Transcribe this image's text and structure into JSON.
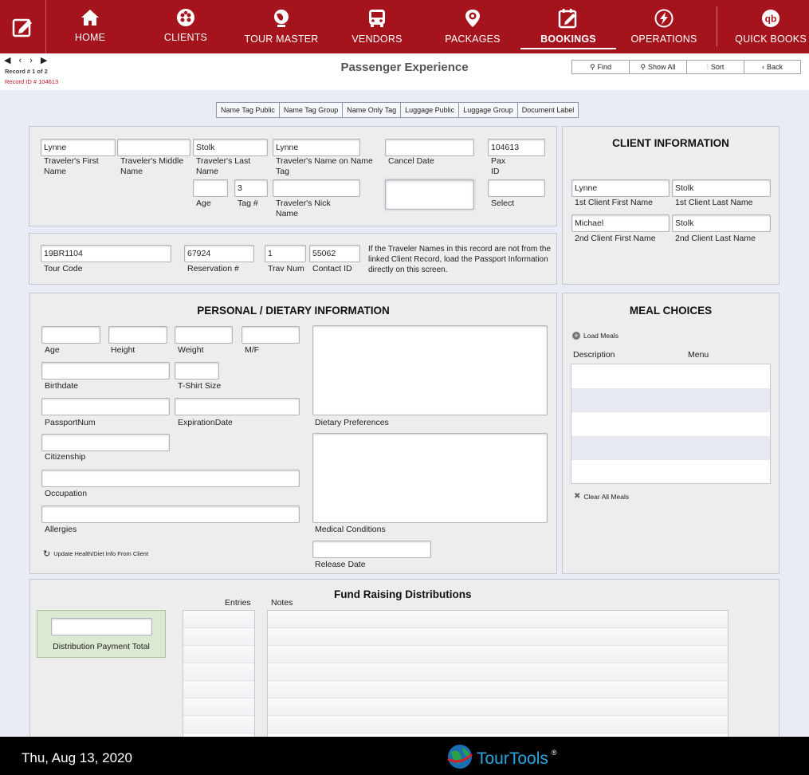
{
  "nav": {
    "items": [
      {
        "label": "HOME",
        "icon": "home-icon"
      },
      {
        "label": "CLIENTS",
        "icon": "clients-icon"
      },
      {
        "label": "TOUR MASTER",
        "icon": "globe-icon"
      },
      {
        "label": "VENDORS",
        "icon": "bus-icon"
      },
      {
        "label": "PACKAGES",
        "icon": "location-pin-icon"
      },
      {
        "label": "BOOKINGS",
        "icon": "calendar-edit-icon"
      },
      {
        "label": "OPERATIONS",
        "icon": "bolt-icon"
      },
      {
        "label": "QUICK BOOKS",
        "icon": "quickbooks-icon"
      }
    ],
    "active": "BOOKINGS"
  },
  "record": {
    "counter": "Record # 1 of 2",
    "id": "Record ID # 104613"
  },
  "page_title": "Passenger Experience",
  "toolbar": {
    "find": "Find",
    "show_all": "Show All",
    "sort": "Sort",
    "back": "Back"
  },
  "tag_buttons": [
    "Name Tag Public",
    "Name Tag Group",
    "Name Only Tag",
    "Luggage Public",
    "Luggage Group",
    "Document Label"
  ],
  "traveler": {
    "first_name": {
      "value": "Lynne",
      "label": "Traveler's First Name"
    },
    "middle_name": {
      "value": "",
      "label": "Traveler's Middle Name"
    },
    "last_name": {
      "value": "Stolk",
      "label": "Traveler's Last Name"
    },
    "tag_name": {
      "value": "Lynne",
      "label": "Traveler's Name on Name Tag"
    },
    "cancel_date": {
      "value": "",
      "label": "Cancel Date"
    },
    "pax_id": {
      "value": "104613",
      "label": "Pax ID"
    },
    "age": {
      "value": "",
      "label": "Age"
    },
    "tag_num": {
      "value": "3",
      "label": "Tag #"
    },
    "nick_name": {
      "value": "",
      "label": "Traveler's Nick Name"
    },
    "select": {
      "value": "",
      "label": "Select"
    }
  },
  "tour": {
    "tour_code": {
      "value": "19BR1104",
      "label": "Tour Code"
    },
    "reservation": {
      "value": "67924",
      "label": "Reservation #"
    },
    "trav_num": {
      "value": "1",
      "label": "Trav Num"
    },
    "contact_id": {
      "value": "55062",
      "label": "Contact ID"
    },
    "note": "If  the Traveler Names in this record are not from the linked Client Record, load the Passport Information directly on this screen."
  },
  "client_info": {
    "title": "CLIENT INFORMATION",
    "first1": {
      "value": "Lynne",
      "label": "1st Client First Name"
    },
    "last1": {
      "value": "Stolk",
      "label": "1st Client Last Name"
    },
    "first2": {
      "value": "Michael",
      "label": "2nd Client First Name"
    },
    "last2": {
      "value": "Stolk",
      "label": "2nd Client Last Name"
    }
  },
  "personal": {
    "title": "PERSONAL / DIETARY INFORMATION",
    "age": {
      "value": "",
      "label": "Age"
    },
    "height": {
      "value": "",
      "label": "Height"
    },
    "weight": {
      "value": "",
      "label": "Weight"
    },
    "mf": {
      "value": "",
      "label": "M/F"
    },
    "birthdate": {
      "value": "",
      "label": "Birthdate"
    },
    "tshirt": {
      "value": "",
      "label": "T-Shirt Size"
    },
    "passport": {
      "value": "",
      "label": "PassportNum"
    },
    "expiration": {
      "value": "",
      "label": "ExpirationDate"
    },
    "citizenship": {
      "value": "",
      "label": "Citizenship"
    },
    "occupation": {
      "value": "",
      "label": "Occupation"
    },
    "allergies": {
      "value": "",
      "label": "Allergies"
    },
    "dietary": {
      "value": "",
      "label": "Dietary Preferences"
    },
    "medical": {
      "value": "",
      "label": "Medical Conditions"
    },
    "release": {
      "value": "",
      "label": "Release Date"
    },
    "update_link": "Update Health/Diet Info From Client"
  },
  "meals": {
    "title": "MEAL CHOICES",
    "load": "Load Meals",
    "col_description": "Description",
    "col_menu": "Menu",
    "clear": "Clear All Meals"
  },
  "fund": {
    "title": "Fund Raising Distributions",
    "entries_label": "Entries",
    "notes_label": "Notes",
    "payment_total": {
      "value": "",
      "label": "Distribution Payment Total"
    }
  },
  "footer": {
    "date": "Thu, Aug 13, 2020",
    "brand": "TourTools",
    "reg": "®"
  }
}
